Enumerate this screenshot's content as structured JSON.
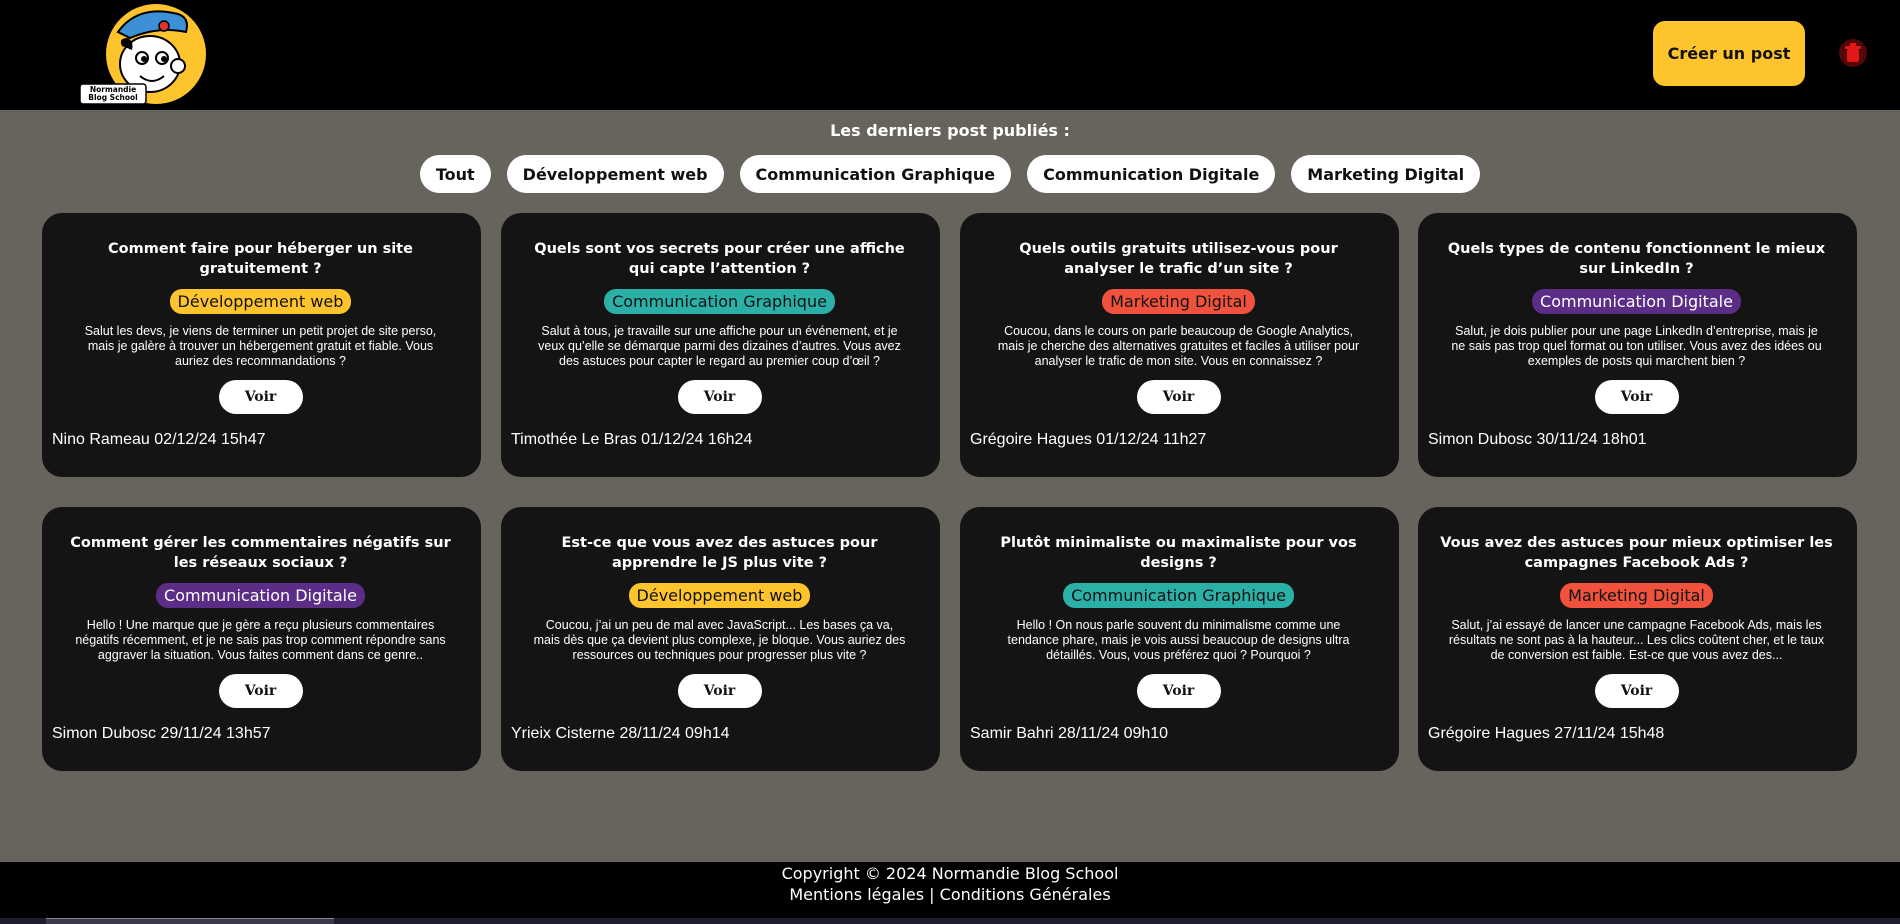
{
  "header": {
    "logo_label": "Normandie Blog School",
    "create_button": "Créer un post"
  },
  "filters": {
    "title": "Les derniers post publiés :",
    "items": [
      "Tout",
      "Développement web",
      "Communication Graphique",
      "Communication Digitale",
      "Marketing Digital"
    ]
  },
  "tag_colors": {
    "Développement web": "#fec42d",
    "Communication Graphique": "#2bb0a8",
    "Marketing Digital": "#f0523d",
    "Communication Digitale": "#5b2d86"
  },
  "posts": [
    {
      "title": "Comment faire pour héberger un site gratuitement ?",
      "tag": "Développement web",
      "text": "Salut les devs, je viens de terminer un petit projet de site perso, mais je galère à trouver un hébergement gratuit et fiable. Vous auriez des recommandations ?",
      "button": "Voir",
      "author": "Nino Rameau 02/12/24 15h47"
    },
    {
      "title": "Quels sont vos secrets pour créer une affiche qui capte l’attention ?",
      "tag": "Communication Graphique",
      "text": "Salut à tous, je travaille sur une affiche pour un événement, et je veux qu’elle se démarque parmi des dizaines d’autres. Vous avez des astuces pour capter le regard au premier coup d’œil ?",
      "button": "Voir",
      "author": "Timothée Le Bras 01/12/24 16h24"
    },
    {
      "title": "Quels outils gratuits utilisez-vous pour analyser le trafic d’un site ?",
      "tag": "Marketing Digital",
      "text": "Coucou, dans le cours on parle beaucoup de Google Analytics, mais je cherche des alternatives gratuites et faciles à utiliser pour analyser le trafic de mon site. Vous en connaissez ?",
      "button": "Voir",
      "author": "Grégoire Hagues 01/12/24 11h27"
    },
    {
      "title": "Quels types de contenu fonctionnent le mieux sur LinkedIn ?",
      "tag": "Communication Digitale",
      "text": "Salut, je dois publier pour une page LinkedIn d’entreprise, mais je ne sais pas trop quel format ou ton utiliser. Vous avez des idées ou exemples de posts qui marchent bien ?",
      "button": "Voir",
      "author": "Simon Dubosc 30/11/24 18h01"
    },
    {
      "title": "Comment gérer les commentaires négatifs sur les réseaux sociaux ?",
      "tag": "Communication Digitale",
      "text": "Hello ! Une marque que je gère a reçu plusieurs commentaires négatifs récemment, et je ne sais pas trop comment répondre sans aggraver la situation. Vous faites comment dans ce genre..",
      "button": "Voir",
      "author": "Simon Dubosc 29/11/24 13h57"
    },
    {
      "title": "Est-ce que vous avez des astuces pour apprendre le JS plus vite ?",
      "tag": "Développement web",
      "text": "Coucou, j’ai un peu de mal avec JavaScript... Les bases ça va, mais dès que ça devient plus complexe, je bloque. Vous auriez des ressources ou techniques pour progresser plus vite ?",
      "button": "Voir",
      "author": "Yrieix Cisterne 28/11/24 09h14"
    },
    {
      "title": "Plutôt minimaliste ou maximaliste pour vos designs ?",
      "tag": "Communication Graphique",
      "text": "Hello ! On nous parle souvent du minimalisme comme une tendance phare, mais je vois aussi beaucoup de designs ultra détaillés. Vous, vous préférez quoi ? Pourquoi ?",
      "button": "Voir",
      "author": "Samir Bahri 28/11/24 09h10"
    },
    {
      "title": "Vous avez des astuces pour mieux optimiser les campagnes Facebook Ads ?",
      "tag": "Marketing Digital",
      "text": "Salut, j’ai essayé de lancer une campagne Facebook Ads, mais les résultats ne sont pas à la hauteur... Les clics coûtent cher, et le taux de conversion est faible. Est-ce que vous avez des...",
      "button": "Voir",
      "author": "Grégoire Hagues 27/11/24 15h48"
    }
  ],
  "footer": {
    "copyright": "Copyright © 2024 Normandie Blog School",
    "legal": "Mentions légales",
    "separator": " | ",
    "terms": "Conditions Générales"
  }
}
